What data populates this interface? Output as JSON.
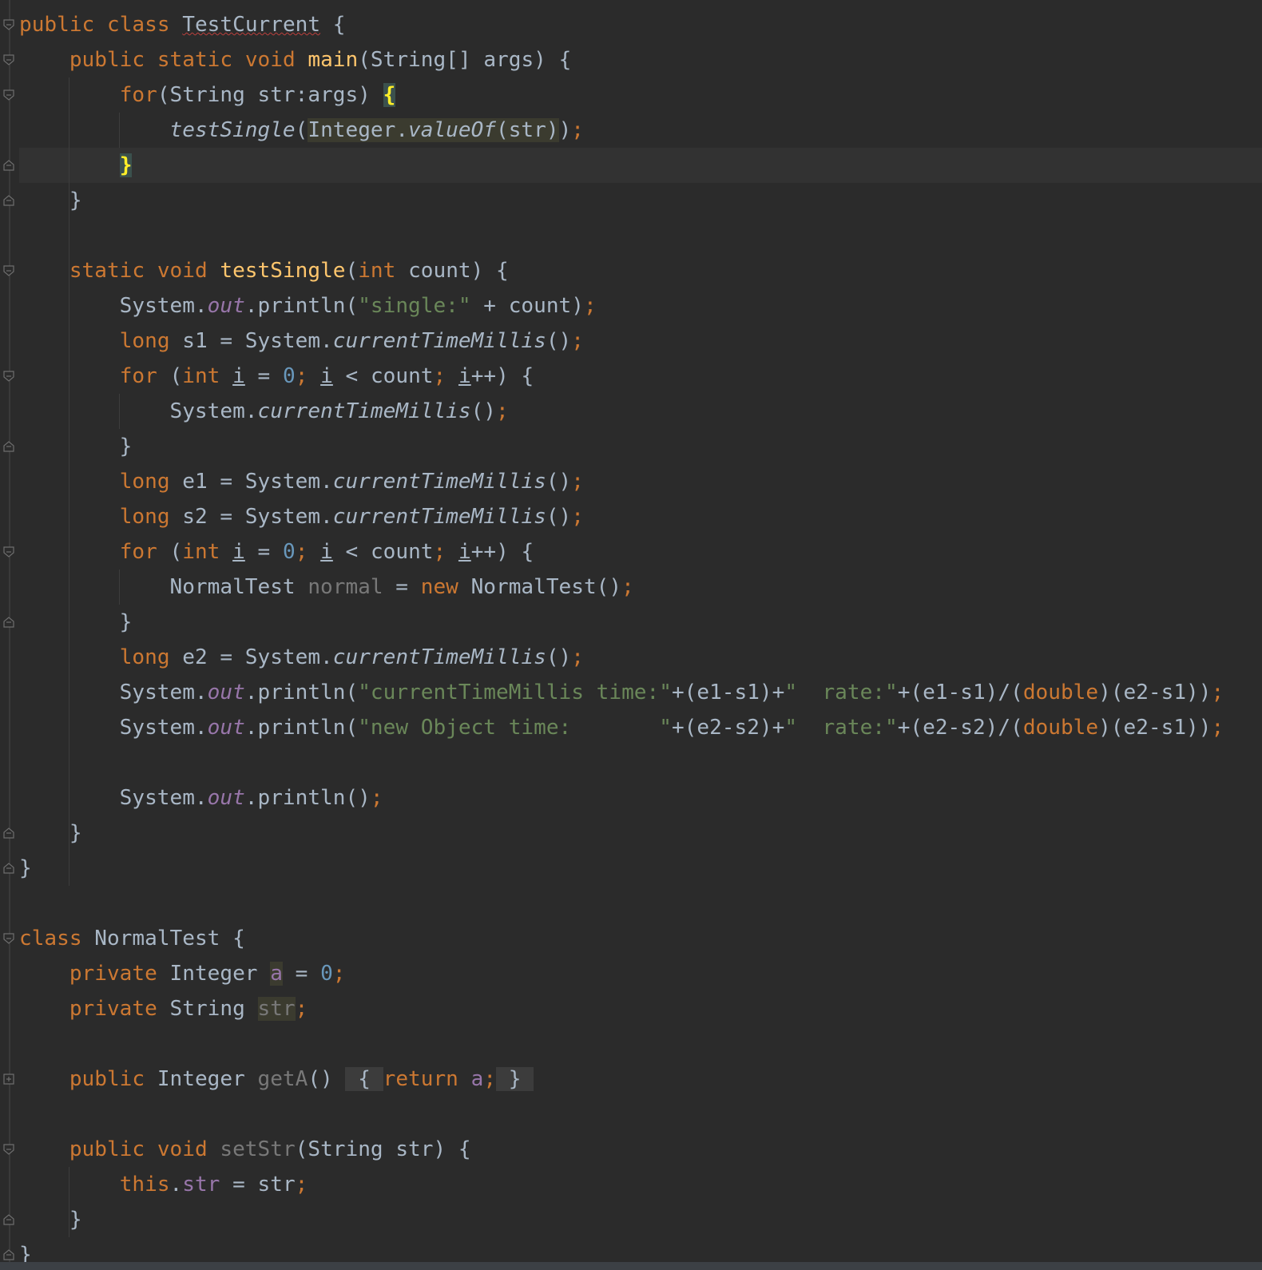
{
  "editor": {
    "lines": [
      {
        "tokens": [
          {
            "t": "public",
            "c": "kw"
          },
          {
            "t": " "
          },
          {
            "t": "class",
            "c": "kw"
          },
          {
            "t": " "
          },
          {
            "t": "TestCurrent",
            "c": "warn"
          },
          {
            "t": " {"
          }
        ]
      },
      {
        "tokens": [
          {
            "t": "    "
          },
          {
            "t": "public",
            "c": "kw"
          },
          {
            "t": " "
          },
          {
            "t": "static",
            "c": "kw"
          },
          {
            "t": " "
          },
          {
            "t": "void",
            "c": "kw"
          },
          {
            "t": " "
          },
          {
            "t": "main",
            "c": "fn"
          },
          {
            "t": "(String[] args) {"
          }
        ]
      },
      {
        "tokens": [
          {
            "t": "        "
          },
          {
            "t": "for",
            "c": "kw"
          },
          {
            "t": "(String str:args) "
          },
          {
            "t": "{",
            "c": "brace-hl"
          }
        ]
      },
      {
        "tokens": [
          {
            "t": "            "
          },
          {
            "t": "testSingle",
            "c": "sm"
          },
          {
            "t": "("
          },
          {
            "t": "Integer.",
            "c": "hl"
          },
          {
            "t": "valueOf",
            "c": "hl sm"
          },
          {
            "t": "(str)",
            "c": "hl"
          },
          {
            "t": ")"
          },
          {
            "t": ";",
            "c": "semi"
          }
        ]
      },
      {
        "current": true,
        "tokens": [
          {
            "t": "        "
          },
          {
            "t": "}",
            "c": "brace-hl"
          }
        ]
      },
      {
        "tokens": [
          {
            "t": "    }"
          }
        ]
      },
      {
        "tokens": []
      },
      {
        "tokens": [
          {
            "t": "    "
          },
          {
            "t": "static",
            "c": "kw"
          },
          {
            "t": " "
          },
          {
            "t": "void",
            "c": "kw"
          },
          {
            "t": " "
          },
          {
            "t": "testSingle",
            "c": "fn"
          },
          {
            "t": "("
          },
          {
            "t": "int",
            "c": "kw"
          },
          {
            "t": " count) {"
          }
        ]
      },
      {
        "tokens": [
          {
            "t": "        System."
          },
          {
            "t": "out",
            "c": "sfld"
          },
          {
            "t": ".println("
          },
          {
            "t": "\"single:\"",
            "c": "str"
          },
          {
            "t": " + count)"
          },
          {
            "t": ";",
            "c": "semi"
          }
        ]
      },
      {
        "tokens": [
          {
            "t": "        "
          },
          {
            "t": "long",
            "c": "kw"
          },
          {
            "t": " s1 = System."
          },
          {
            "t": "currentTimeMillis",
            "c": "sm"
          },
          {
            "t": "()"
          },
          {
            "t": ";",
            "c": "semi"
          }
        ]
      },
      {
        "tokens": [
          {
            "t": "        "
          },
          {
            "t": "for",
            "c": "kw"
          },
          {
            "t": " ("
          },
          {
            "t": "int",
            "c": "kw"
          },
          {
            "t": " "
          },
          {
            "t": "i",
            "c": "ul"
          },
          {
            "t": " = "
          },
          {
            "t": "0",
            "c": "num"
          },
          {
            "t": ";",
            "c": "semi"
          },
          {
            "t": " "
          },
          {
            "t": "i",
            "c": "ul"
          },
          {
            "t": " < count"
          },
          {
            "t": ";",
            "c": "semi"
          },
          {
            "t": " "
          },
          {
            "t": "i",
            "c": "ul"
          },
          {
            "t": "++) {"
          }
        ]
      },
      {
        "tokens": [
          {
            "t": "            System."
          },
          {
            "t": "currentTimeMillis",
            "c": "sm"
          },
          {
            "t": "()"
          },
          {
            "t": ";",
            "c": "semi"
          }
        ]
      },
      {
        "tokens": [
          {
            "t": "        }"
          }
        ]
      },
      {
        "tokens": [
          {
            "t": "        "
          },
          {
            "t": "long",
            "c": "kw"
          },
          {
            "t": " e1 = System."
          },
          {
            "t": "currentTimeMillis",
            "c": "sm"
          },
          {
            "t": "()"
          },
          {
            "t": ";",
            "c": "semi"
          }
        ]
      },
      {
        "tokens": [
          {
            "t": "        "
          },
          {
            "t": "long",
            "c": "kw"
          },
          {
            "t": " s2 = System."
          },
          {
            "t": "currentTimeMillis",
            "c": "sm"
          },
          {
            "t": "()"
          },
          {
            "t": ";",
            "c": "semi"
          }
        ]
      },
      {
        "tokens": [
          {
            "t": "        "
          },
          {
            "t": "for",
            "c": "kw"
          },
          {
            "t": " ("
          },
          {
            "t": "int",
            "c": "kw"
          },
          {
            "t": " "
          },
          {
            "t": "i",
            "c": "ul"
          },
          {
            "t": " = "
          },
          {
            "t": "0",
            "c": "num"
          },
          {
            "t": ";",
            "c": "semi"
          },
          {
            "t": " "
          },
          {
            "t": "i",
            "c": "ul"
          },
          {
            "t": " < count"
          },
          {
            "t": ";",
            "c": "semi"
          },
          {
            "t": " "
          },
          {
            "t": "i",
            "c": "ul"
          },
          {
            "t": "++) {"
          }
        ]
      },
      {
        "tokens": [
          {
            "t": "            NormalTest "
          },
          {
            "t": "normal",
            "c": "unused"
          },
          {
            "t": " = "
          },
          {
            "t": "new",
            "c": "kw"
          },
          {
            "t": " NormalTest()"
          },
          {
            "t": ";",
            "c": "semi"
          }
        ]
      },
      {
        "tokens": [
          {
            "t": "        }"
          }
        ]
      },
      {
        "tokens": [
          {
            "t": "        "
          },
          {
            "t": "long",
            "c": "kw"
          },
          {
            "t": " e2 = System."
          },
          {
            "t": "currentTimeMillis",
            "c": "sm"
          },
          {
            "t": "()"
          },
          {
            "t": ";",
            "c": "semi"
          }
        ]
      },
      {
        "tokens": [
          {
            "t": "        System."
          },
          {
            "t": "out",
            "c": "sfld"
          },
          {
            "t": ".println("
          },
          {
            "t": "\"currentTimeMillis time:\"",
            "c": "str"
          },
          {
            "t": "+(e1-s1)+"
          },
          {
            "t": "\"  rate:\"",
            "c": "str"
          },
          {
            "t": "+(e1-s1)/("
          },
          {
            "t": "double",
            "c": "kw"
          },
          {
            "t": ")(e2-s1))"
          },
          {
            "t": ";",
            "c": "semi"
          }
        ]
      },
      {
        "tokens": [
          {
            "t": "        System."
          },
          {
            "t": "out",
            "c": "sfld"
          },
          {
            "t": ".println("
          },
          {
            "t": "\"new Object time:       \"",
            "c": "str"
          },
          {
            "t": "+(e2-s2)+"
          },
          {
            "t": "\"  rate:\"",
            "c": "str"
          },
          {
            "t": "+(e2-s2)/("
          },
          {
            "t": "double",
            "c": "kw"
          },
          {
            "t": ")(e2-s1))"
          },
          {
            "t": ";",
            "c": "semi"
          }
        ]
      },
      {
        "tokens": []
      },
      {
        "tokens": [
          {
            "t": "        System."
          },
          {
            "t": "out",
            "c": "sfld"
          },
          {
            "t": ".println()"
          },
          {
            "t": ";",
            "c": "semi"
          }
        ]
      },
      {
        "tokens": [
          {
            "t": "    }"
          }
        ]
      },
      {
        "tokens": [
          {
            "t": "}"
          }
        ]
      },
      {
        "tokens": []
      },
      {
        "tokens": [
          {
            "t": "class",
            "c": "kw"
          },
          {
            "t": " NormalTest {"
          }
        ]
      },
      {
        "tokens": [
          {
            "t": "    "
          },
          {
            "t": "private",
            "c": "kw"
          },
          {
            "t": " Integer "
          },
          {
            "t": "a",
            "c": "fld hl"
          },
          {
            "t": " = "
          },
          {
            "t": "0",
            "c": "num"
          },
          {
            "t": ";",
            "c": "semi"
          }
        ]
      },
      {
        "tokens": [
          {
            "t": "    "
          },
          {
            "t": "private",
            "c": "kw"
          },
          {
            "t": " String "
          },
          {
            "t": "str",
            "c": "unused hl"
          },
          {
            "t": ";",
            "c": "semi"
          }
        ]
      },
      {
        "tokens": []
      },
      {
        "tokens": [
          {
            "t": "    "
          },
          {
            "t": "public",
            "c": "kw"
          },
          {
            "t": " Integer "
          },
          {
            "t": "getA",
            "c": "unused"
          },
          {
            "t": "() "
          },
          {
            "t": " { ",
            "c": "fold-inline"
          },
          {
            "t": "return",
            "c": "kw"
          },
          {
            "t": " "
          },
          {
            "t": "a",
            "c": "fld"
          },
          {
            "t": ";",
            "c": "semi"
          },
          {
            "t": " } ",
            "c": "fold-inline"
          }
        ]
      },
      {
        "tokens": []
      },
      {
        "tokens": [
          {
            "t": "    "
          },
          {
            "t": "public",
            "c": "kw"
          },
          {
            "t": " "
          },
          {
            "t": "void",
            "c": "kw"
          },
          {
            "t": " "
          },
          {
            "t": "setStr",
            "c": "unused"
          },
          {
            "t": "(String str) {"
          }
        ]
      },
      {
        "tokens": [
          {
            "t": "        "
          },
          {
            "t": "this",
            "c": "kw"
          },
          {
            "t": "."
          },
          {
            "t": "str",
            "c": "fld"
          },
          {
            "t": " = str"
          },
          {
            "t": ";",
            "c": "semi"
          }
        ]
      },
      {
        "tokens": [
          {
            "t": "    }"
          }
        ]
      },
      {
        "tokens": [
          {
            "t": "}"
          }
        ]
      }
    ],
    "fold_markers": [
      {
        "line": 0,
        "kind": "open"
      },
      {
        "line": 1,
        "kind": "open"
      },
      {
        "line": 2,
        "kind": "open"
      },
      {
        "line": 4,
        "kind": "close"
      },
      {
        "line": 5,
        "kind": "close"
      },
      {
        "line": 7,
        "kind": "open"
      },
      {
        "line": 10,
        "kind": "open"
      },
      {
        "line": 12,
        "kind": "close"
      },
      {
        "line": 15,
        "kind": "open"
      },
      {
        "line": 17,
        "kind": "close"
      },
      {
        "line": 23,
        "kind": "close"
      },
      {
        "line": 24,
        "kind": "close"
      },
      {
        "line": 26,
        "kind": "open"
      },
      {
        "line": 30,
        "kind": "collapsed"
      },
      {
        "line": 32,
        "kind": "open"
      },
      {
        "line": 34,
        "kind": "close"
      },
      {
        "line": 35,
        "kind": "close"
      }
    ],
    "colors": {
      "background": "#2b2b2b",
      "keyword": "#cc7832",
      "method_declaration": "#ffc66d",
      "string": "#6a8759",
      "number": "#6897bb",
      "field": "#9876aa",
      "plain": "#a9b7c6",
      "unused": "#787878",
      "brace_match": "#ffef28"
    }
  }
}
